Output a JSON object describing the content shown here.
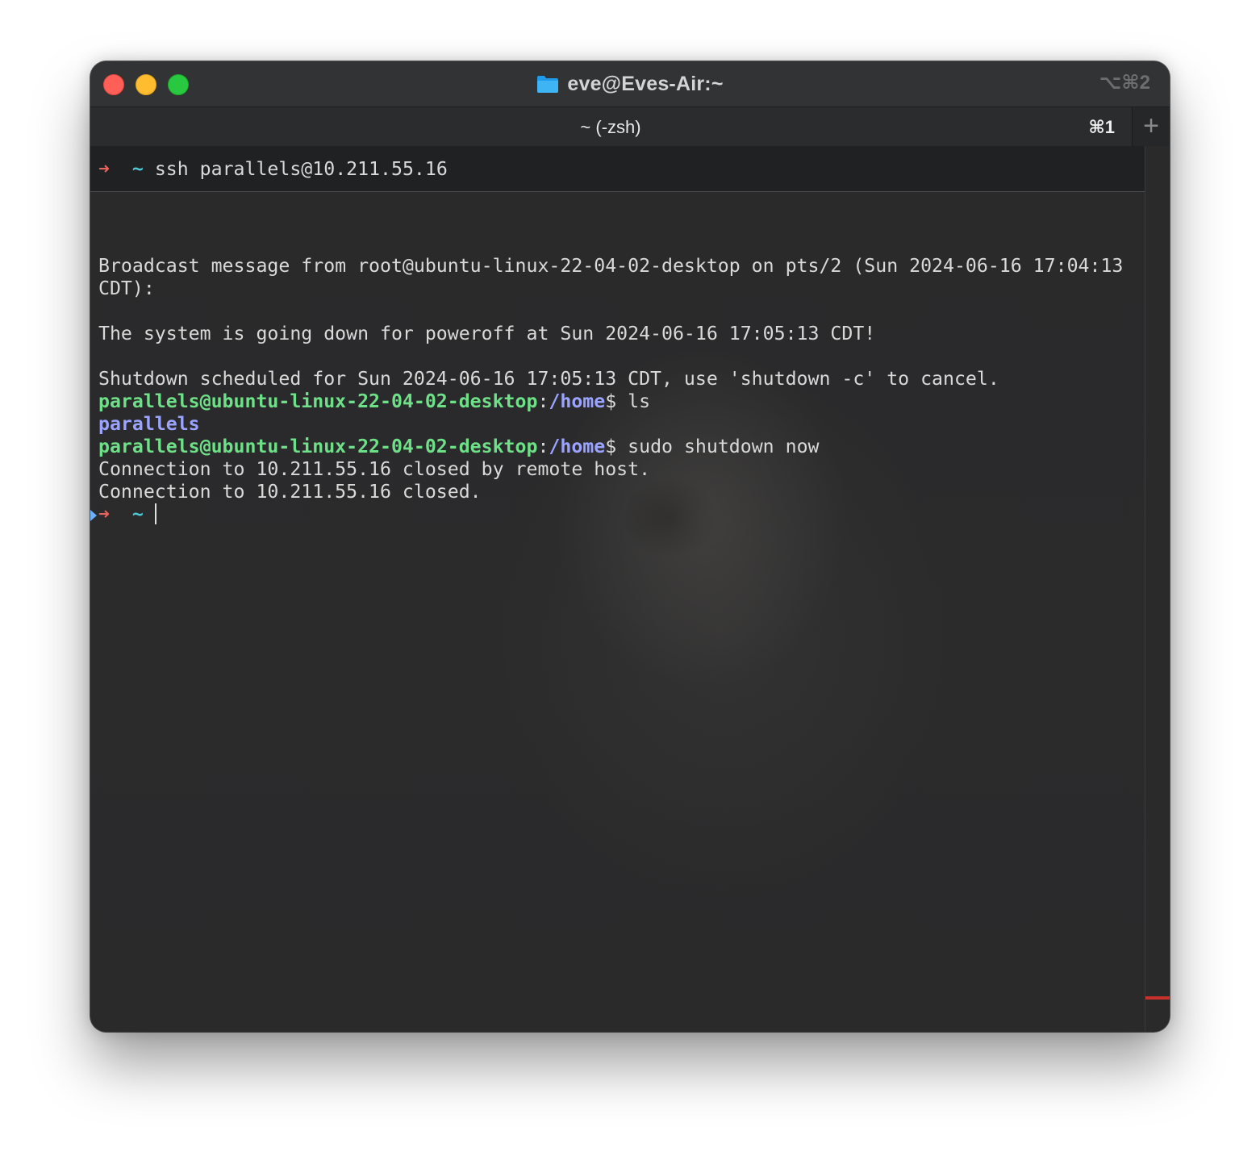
{
  "window": {
    "title": "eve@Eves-Air:~",
    "shortcut": "⌥⌘2",
    "icons": [
      "folder-icon"
    ]
  },
  "tabs": [
    {
      "label": "~ (-zsh)",
      "shortcut": "⌘1"
    }
  ],
  "new_tab_glyph": "+",
  "prompt": {
    "arrow": "➜",
    "tilde": "~"
  },
  "sticky_command": {
    "command": "ssh parallels@10.211.55.16"
  },
  "output": {
    "broadcast_1": "Broadcast message from root@ubuntu-linux-22-04-02-desktop on pts/2 (Sun 2024-06-16 17:04:13",
    "broadcast_2": "CDT):",
    "poweroff": "The system is going down for poweroff at Sun 2024-06-16 17:05:13 CDT!",
    "scheduled": "Shutdown scheduled for Sun 2024-06-16 17:05:13 CDT, use 'shutdown -c' to cancel.",
    "ls_result": "parallels",
    "closed_remote": "Connection to 10.211.55.16 closed by remote host.",
    "closed": "Connection to 10.211.55.16 closed."
  },
  "remote_prompt": {
    "user_host": "parallels@ubuntu-linux-22-04-02-desktop",
    "colon": ":",
    "path": "/home",
    "dollar": "$",
    "cmd_1": " ls",
    "cmd_2": " sudo shutdown now"
  },
  "colors": {
    "close": "#ff5f57",
    "minimize": "#febc2e",
    "maximize": "#28c840",
    "prompt_arrow": "#e8625e",
    "prompt_tilde": "#4ec9d6",
    "user_host": "#6ee088",
    "path": "#9aa3ff",
    "scroll_mark": "#c8302c"
  }
}
